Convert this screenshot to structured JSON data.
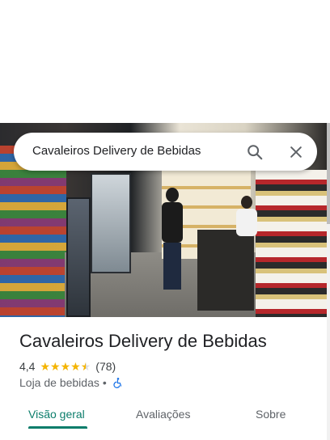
{
  "search": {
    "query": "Cavaleiros Delivery de Bebidas",
    "search_icon": "search-icon",
    "close_icon": "close-icon"
  },
  "place": {
    "name": "Cavaleiros Delivery de Bebidas",
    "rating": "4,4",
    "stars_value": 4.4,
    "reviews_count": "(78)",
    "category": "Loja de bebidas",
    "separator": "•",
    "accessibility_icon": "wheelchair-icon"
  },
  "tabs": [
    {
      "label": "Visão geral",
      "active": true
    },
    {
      "label": "Avaliações",
      "active": false
    },
    {
      "label": "Sobre",
      "active": false
    }
  ],
  "colors": {
    "accent": "#0b7d6b",
    "star": "#f4b400",
    "text_primary": "#202124",
    "text_secondary": "#5f6368",
    "accessibility_blue": "#1a73e8"
  }
}
